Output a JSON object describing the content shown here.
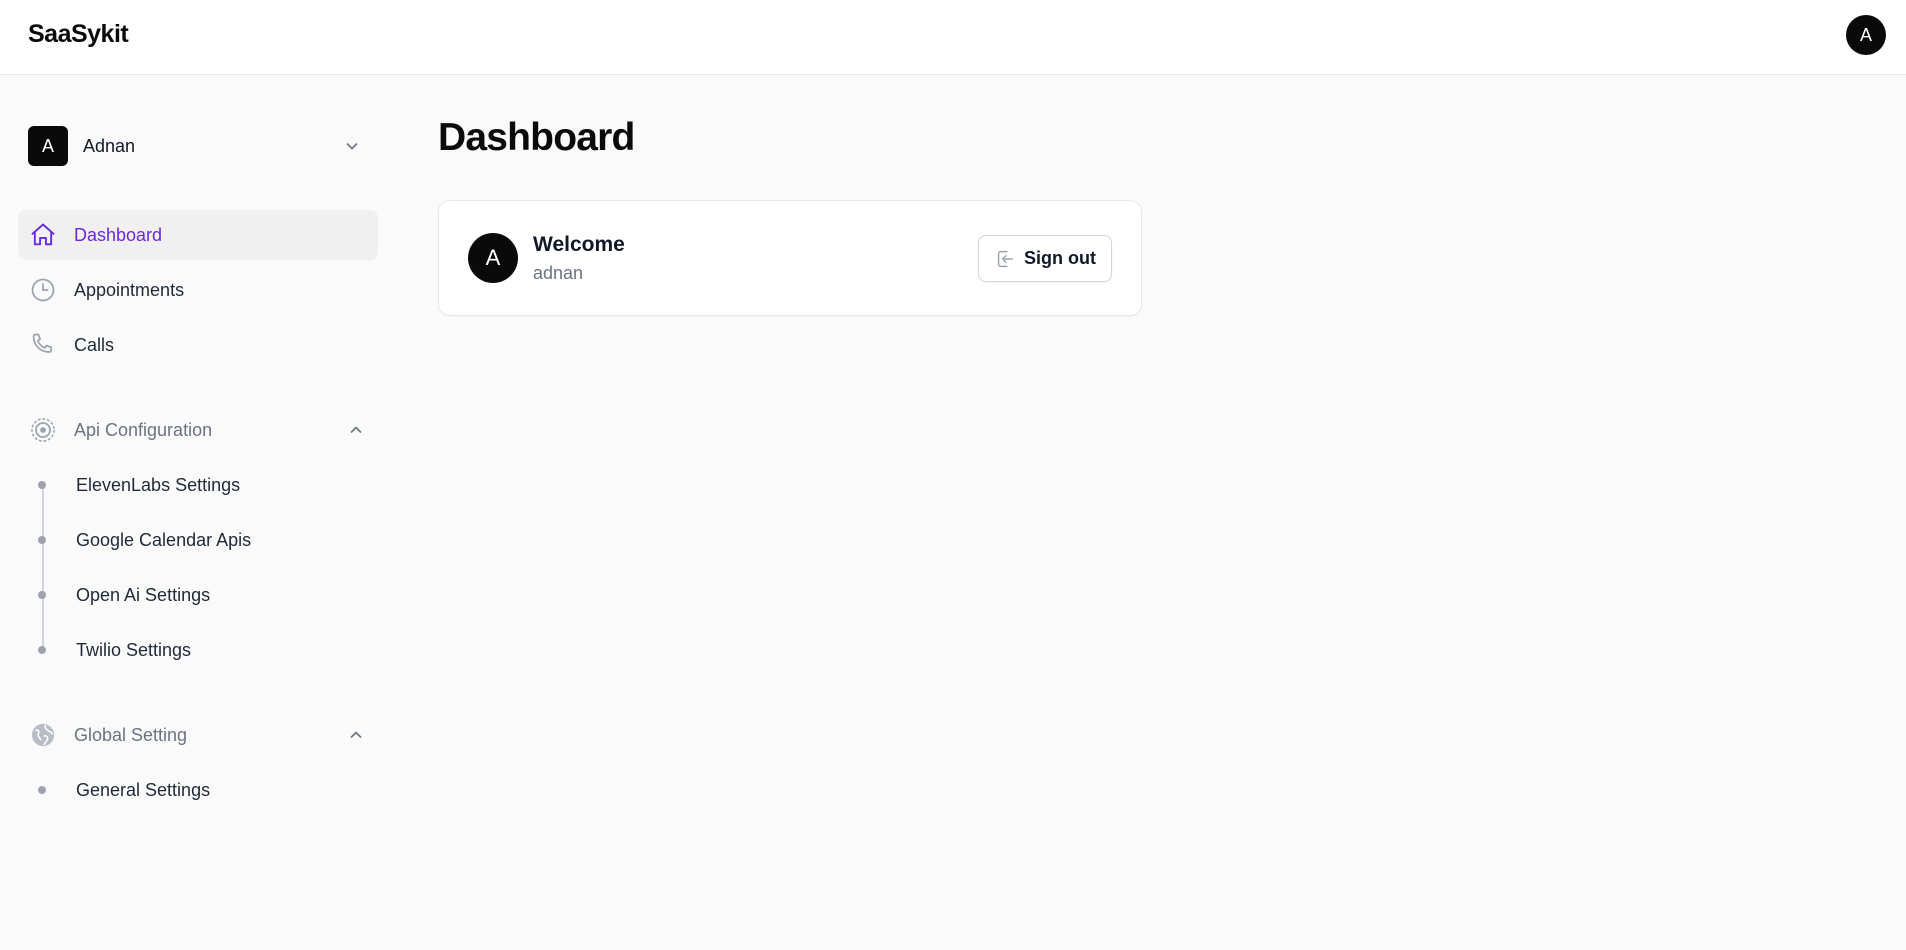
{
  "app": {
    "brand": "SaaSykit",
    "user_initial": "A"
  },
  "colors": {
    "accent": "#6d28d9",
    "dark": "#0a0a0a",
    "muted": "#6b7280",
    "background": "#fafafa"
  },
  "sidebar": {
    "tenant": {
      "initial": "A",
      "name": "Adnan",
      "icon": "chevron-down-icon"
    },
    "nav": [
      {
        "label": "Dashboard",
        "icon": "home-icon",
        "active": true
      },
      {
        "label": "Appointments",
        "icon": "clock-icon",
        "active": false
      },
      {
        "label": "Calls",
        "icon": "phone-icon",
        "active": false
      }
    ],
    "groups": [
      {
        "label": "Api Configuration",
        "icon": "cog-icon",
        "expanded": true,
        "items": [
          {
            "label": "ElevenLabs Settings"
          },
          {
            "label": "Google Calendar Apis"
          },
          {
            "label": "Open Ai Settings"
          },
          {
            "label": "Twilio Settings"
          }
        ]
      },
      {
        "label": "Global Setting",
        "icon": "globe-icon",
        "expanded": true,
        "items": [
          {
            "label": "General Settings"
          }
        ]
      }
    ]
  },
  "main": {
    "title": "Dashboard",
    "welcome_card": {
      "avatar_initial": "A",
      "title": "Welcome",
      "subtitle": "adnan",
      "signout_label": "Sign out",
      "signout_icon": "sign-out-icon"
    }
  }
}
